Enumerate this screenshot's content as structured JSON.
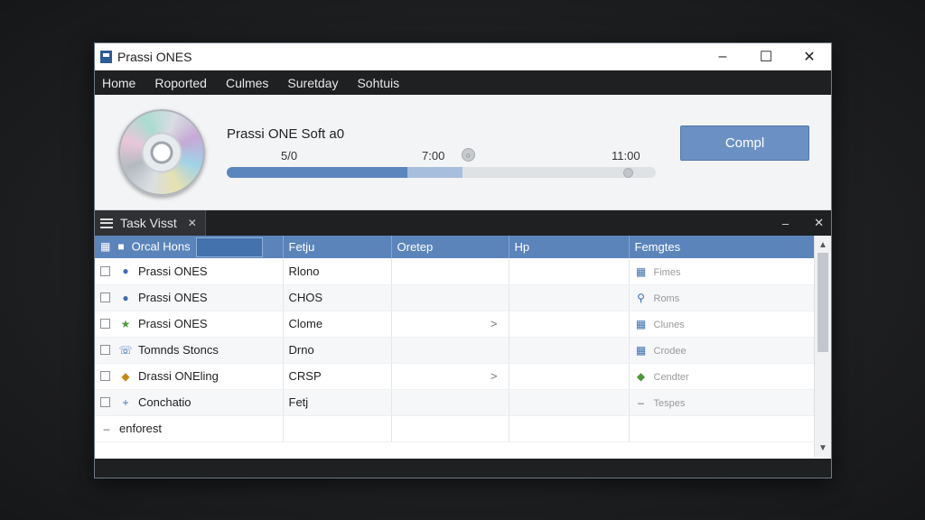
{
  "window": {
    "title": "Prassi ONES"
  },
  "menu": [
    "Home",
    "Roported",
    "Culmes",
    "Suretday",
    "Sohtuis"
  ],
  "player": {
    "track_title": "Prassi ONE Soft a0",
    "time_start": "5/0",
    "time_mid": "7:00",
    "time_end": "11:00",
    "progress_fraction": 0.42,
    "buffer_fraction": 0.55,
    "action_button": "Compl"
  },
  "panel": {
    "tab_label": "Task Visst"
  },
  "table": {
    "columns": [
      "Orcal Hons",
      "Fetju",
      "Oretep",
      "Hp",
      "Femgtes"
    ],
    "rows": [
      {
        "icon": "pencil-blue-icon",
        "name": "Prassi ONES",
        "c2": "Rlono",
        "c3": "",
        "c4": "",
        "c5": "Fimes",
        "c5_icon": "chart-icon"
      },
      {
        "icon": "compass-blue-icon",
        "name": "Prassi ONES",
        "c2": "CHOS",
        "c3": "",
        "c4": "",
        "c5": "Roms",
        "c5_icon": "search-icon"
      },
      {
        "icon": "star-green-icon",
        "name": "Prassi ONES",
        "c2": "Clome",
        "c3": ">",
        "c4": "",
        "c5": "Clunes",
        "c5_icon": "grid-icon"
      },
      {
        "icon": "phone-blue-icon",
        "name": "Tomnds Stoncs",
        "c2": "Drno",
        "c3": "",
        "c4": "",
        "c5": "Crodee",
        "c5_icon": "chart-icon"
      },
      {
        "icon": "tag-orange-icon",
        "name": "Drassi ONEling",
        "c2": "CRSP",
        "c3": ">",
        "c4": "",
        "c5": "Cendter",
        "c5_icon": "shield-icon"
      },
      {
        "icon": "plus-blue-icon",
        "name": "Conchatio",
        "c2": "Fetj",
        "c3": "",
        "c4": "",
        "c5": "Tespes",
        "c5_icon": "dash-icon"
      },
      {
        "icon": "dash-icon",
        "name": "enforest",
        "c2": "",
        "c3": "",
        "c4": "",
        "c5": "",
        "c5_icon": ""
      }
    ]
  }
}
